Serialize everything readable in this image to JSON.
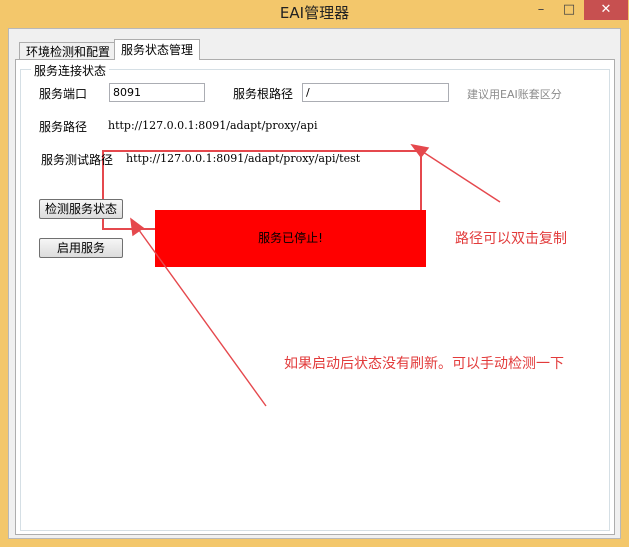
{
  "window": {
    "title": "EAI管理器",
    "minimize_glyph": "–",
    "maximize_glyph": "□",
    "close_glyph": "✕"
  },
  "tabs": [
    {
      "label": "环境检测和配置",
      "selected": false
    },
    {
      "label": "服务状态管理",
      "selected": true
    }
  ],
  "group": {
    "title": "服务连接状态",
    "port_label": "服务端口",
    "port_value": "8091",
    "root_label": "服务根路径",
    "root_value": "/",
    "root_hint": "建议用EAI账套区分",
    "path_label": "服务路径",
    "path_value": "http://127.0.0.1:8091/adapt/proxy/api",
    "test_label": "服务测试路径",
    "test_value": "http://127.0.0.1:8091/adapt/proxy/api/test",
    "check_button": "检测服务状态",
    "start_button": "启用服务",
    "status_text": "服务已停止!"
  },
  "annotations": {
    "copy_note": "路径可以双击复制",
    "refresh_note": "如果启动后状态没有刷新。可以手动检测一下"
  },
  "colors": {
    "titlebar": "#f3c76b",
    "close": "#c75050",
    "status_bg": "#ff0000",
    "annotation": "#e23b3b"
  }
}
